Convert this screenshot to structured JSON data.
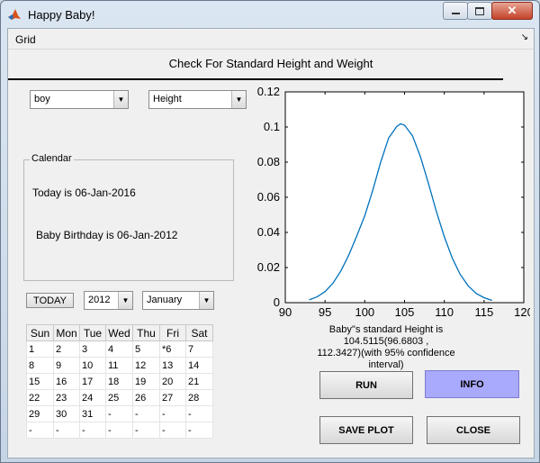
{
  "window": {
    "title": "Happy Baby!"
  },
  "menu": {
    "items": [
      "Grid"
    ]
  },
  "header": {
    "title": "Check For Standard Height and Weight"
  },
  "selectors": {
    "gender": "boy",
    "measure": "Height",
    "year": "2012",
    "month": "January"
  },
  "calendar_group": {
    "label": "Calendar",
    "today_text": "Today is  06-Jan-2016",
    "birthday_text": "Baby Birthday is  06-Jan-2012"
  },
  "today_button": "TODAY",
  "calendar": {
    "headers": [
      "Sun",
      "Mon",
      "Tue",
      "Wed",
      "Thu",
      "Fri",
      "Sat"
    ],
    "rows": [
      [
        "1",
        "2",
        "3",
        "4",
        "5",
        "*6",
        "7"
      ],
      [
        "8",
        "9",
        "10",
        "11",
        "12",
        "13",
        "14"
      ],
      [
        "15",
        "16",
        "17",
        "18",
        "19",
        "20",
        "21"
      ],
      [
        "22",
        "23",
        "24",
        "25",
        "26",
        "27",
        "28"
      ],
      [
        "29",
        "30",
        "31",
        "-",
        "-",
        "-",
        "-"
      ],
      [
        "-",
        "-",
        "-",
        "-",
        "-",
        "-",
        "-"
      ]
    ]
  },
  "result": {
    "line1": "Baby''s standard Height is",
    "line2": "104.5115(96.6803 ,",
    "line3": "112.3427)(with 95% confidence interval)"
  },
  "buttons": {
    "run": "RUN",
    "info": "INFO",
    "save_plot": "SAVE PLOT",
    "close": "CLOSE"
  },
  "chart_data": {
    "type": "line",
    "title": "",
    "xlabel": "",
    "ylabel": "",
    "xlim": [
      90,
      120
    ],
    "ylim": [
      0,
      0.12
    ],
    "xticks": [
      90,
      95,
      100,
      105,
      110,
      115,
      120
    ],
    "yticks": [
      0,
      0.02,
      0.04,
      0.06,
      0.08,
      0.1,
      0.12
    ],
    "line_color": "#0072bd",
    "x": [
      93,
      94,
      95,
      96,
      97,
      98,
      99,
      100,
      101,
      102,
      103,
      104,
      104.5,
      105,
      106,
      107,
      108,
      109,
      110,
      111,
      112,
      113,
      114,
      115,
      116
    ],
    "y": [
      0.0016,
      0.0033,
      0.0063,
      0.0111,
      0.0181,
      0.0273,
      0.0381,
      0.0495,
      0.064,
      0.08,
      0.0937,
      0.1002,
      0.1018,
      0.101,
      0.095,
      0.083,
      0.068,
      0.052,
      0.0375,
      0.0254,
      0.0161,
      0.0096,
      0.0053,
      0.0028,
      0.0013
    ]
  }
}
